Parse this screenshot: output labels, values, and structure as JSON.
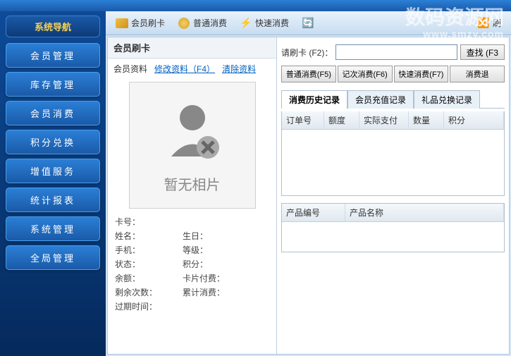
{
  "sidebar": {
    "title": "系统导航",
    "items": [
      {
        "label": "会员管理"
      },
      {
        "label": "库存管理"
      },
      {
        "label": "会员消费"
      },
      {
        "label": "积分兑换"
      },
      {
        "label": "增值服务"
      },
      {
        "label": "统计报表"
      },
      {
        "label": "系统管理"
      },
      {
        "label": "全局管理"
      }
    ]
  },
  "toolbar": {
    "swipe_card": "会员刷卡",
    "normal_consume": "普通消费",
    "quick_consume": "快速消费",
    "refresh": "刷"
  },
  "panel": {
    "title": "会员刷卡",
    "member_info": "会员资料",
    "edit_info": "修改资料（F4）",
    "clear_info": "清除资料",
    "no_photo": "暂无相片",
    "fields": {
      "card_no": "卡号：",
      "name": "姓名：",
      "birthday": "生日：",
      "phone": "手机：",
      "level": "等级：",
      "status": "状态：",
      "points": "积分：",
      "balance": "余额：",
      "card_pay": "卡片付费：",
      "remain_count": "剩余次数：",
      "total_consume": "累计消费：",
      "expire_time": "过期时间："
    }
  },
  "right": {
    "swipe_label": "请刷卡 (F2)：",
    "find_btn": "查找 (F3",
    "buttons": [
      "普通消费(F5)",
      "记次消费(F6)",
      "快速消费(F7)",
      "消费退"
    ],
    "tabs": [
      "消费历史记录",
      "会员充值记录",
      "礼品兑换记录"
    ],
    "history_cols": [
      "订单号",
      "额度",
      "实际支付",
      "数量",
      "积分"
    ],
    "product_cols": [
      "产品编号",
      "产品名称"
    ]
  },
  "watermark": {
    "main": "数码资源网",
    "sub": "www.smzy.com"
  }
}
